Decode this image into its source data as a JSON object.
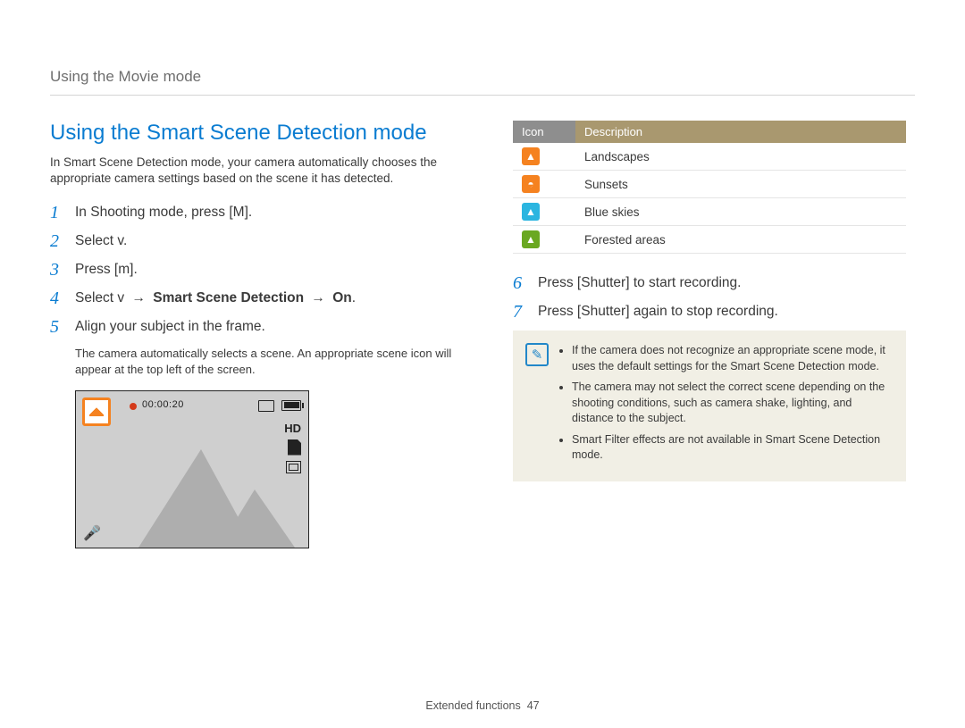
{
  "breadcrumb": "Using the Movie mode",
  "heading": "Using the Smart Scene Detection mode",
  "intro": "In Smart Scene Detection mode, your camera automatically chooses the appropriate camera settings based on the scene it has detected.",
  "steps": {
    "s1": {
      "num": "1",
      "text_pre": "In Shooting mode, press [",
      "glyph": "M",
      "text_post": "]."
    },
    "s2": {
      "num": "2",
      "text_pre": "Select ",
      "glyph": "v",
      "text_post": "."
    },
    "s3": {
      "num": "3",
      "text_pre": "Press [",
      "glyph": "m",
      "text_post": "]."
    },
    "s4": {
      "num": "4",
      "text_pre": "Select ",
      "glyph": "v",
      "arrow1": " → ",
      "mid": "Smart Scene Detection",
      "arrow2": " → ",
      "end": "On",
      "period": "."
    },
    "s5": {
      "num": "5",
      "text": "Align your subject in the frame.",
      "sub": "The camera automatically selects a scene. An appropriate scene icon will appear at the top left of the screen."
    },
    "s6": {
      "num": "6",
      "text": "Press [Shutter] to start recording."
    },
    "s7": {
      "num": "7",
      "text": "Press [Shutter] again to stop recording."
    }
  },
  "preview": {
    "rec_time": "00:00:20",
    "hd": "HD"
  },
  "icon_table": {
    "header_icon": "Icon",
    "header_desc": "Description",
    "rows": [
      {
        "color": "#f58220",
        "glyph": "▲",
        "desc": "Landscapes"
      },
      {
        "color": "#f58220",
        "glyph": "◓",
        "desc": "Sunsets"
      },
      {
        "color": "#2bb5e0",
        "glyph": "▲",
        "desc": "Blue skies"
      },
      {
        "color": "#6aa821",
        "glyph": "▲",
        "desc": "Forested areas"
      }
    ]
  },
  "notes": [
    "If the camera does not recognize an appropriate scene mode, it uses the default settings for the Smart Scene Detection mode.",
    "The camera may not select the correct scene depending on the shooting conditions, such as camera shake, lighting, and distance to the subject.",
    "Smart Filter effects are not available in Smart Scene Detection mode."
  ],
  "footer": {
    "section": "Extended functions",
    "page": "47"
  }
}
